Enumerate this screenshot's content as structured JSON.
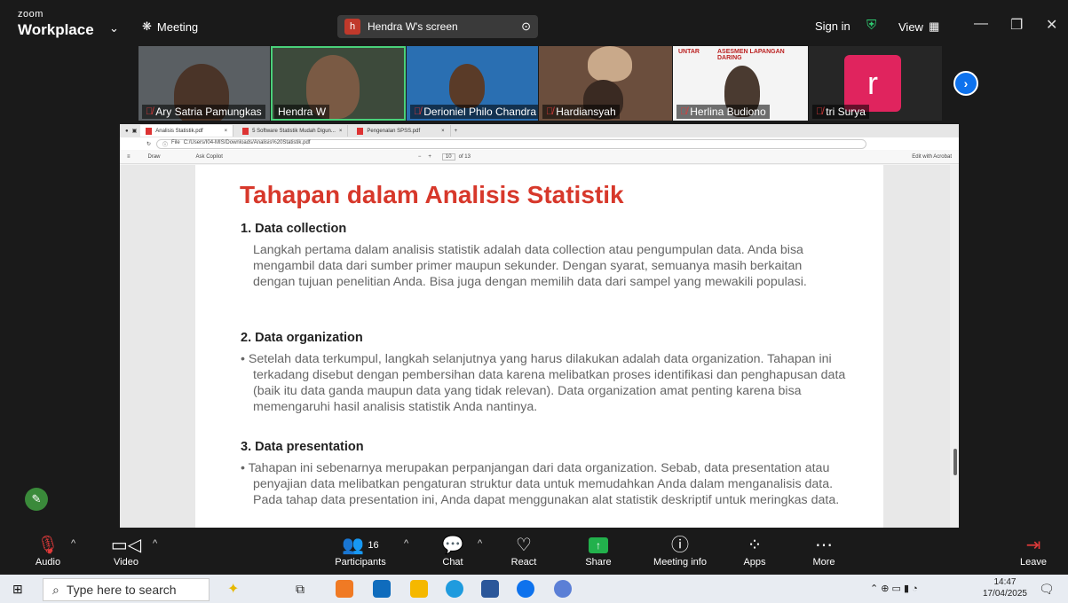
{
  "topbar": {
    "app_small": "zoom",
    "app_big": "Workplace",
    "meeting_label": "Meeting",
    "share_letter": "h",
    "share_label": "Hendra W's screen",
    "sign_in": "Sign in",
    "view": "View"
  },
  "participants_strip": [
    {
      "name": "Ary Satria Pamungkas",
      "muted": true
    },
    {
      "name": "Hendra W",
      "muted": false
    },
    {
      "name": "Derioniel Philo Chandra",
      "muted": true
    },
    {
      "name": "Hardiansyah",
      "muted": true
    },
    {
      "name": "Herlina Budiono",
      "muted": true
    },
    {
      "name": "tri Surya",
      "muted": true,
      "avatar_letter": "r"
    }
  ],
  "banner": {
    "line1": "ASESMEN LAPANGAN DARING",
    "logo": "UNTAR"
  },
  "browser": {
    "tabs": [
      "Analisis Statistik.pdf",
      "5 Software Statistik Mudah Digun...",
      "Pengenalan SPSS.pdf"
    ],
    "url": "C:/Users/I04-MIS/Downloads/Analisis%20Statistik.pdf",
    "url_prefix": "File",
    "toolbar": {
      "draw": "Draw",
      "ask": "Ask Copilot",
      "page": "10",
      "of": "of 13",
      "edit": "Edit with Acrobat"
    }
  },
  "document": {
    "title": "Tahapan dalam Analisis Statistik",
    "s1_heading": "1. Data collection",
    "s1_text": "Langkah pertama dalam analisis statistik adalah data collection atau pengumpulan data. Anda bisa mengambil data dari sumber primer maupun sekunder. Dengan syarat, semuanya masih berkaitan dengan tujuan penelitian Anda. Bisa juga dengan memilih data dari sampel yang mewakili populasi.",
    "s2_heading": "2. Data organization",
    "s2_text": "• Setelah data terkumpul, langkah selanjutnya yang harus dilakukan adalah data organization. Tahapan ini terkadang disebut dengan pembersihan data karena melibatkan proses identifikasi dan penghapusan data (baik itu data ganda maupun data yang tidak relevan). Data organization amat penting karena bisa memengaruhi hasil analisis statistik Anda nantinya.",
    "s3_heading": "3. Data presentation",
    "s3_text": "• Tahapan ini sebenarnya merupakan perpanjangan dari data organization. Sebab, data presentation atau penyajian data melibatkan pengaturan struktur data untuk memudahkan Anda dalam menganalisis data. Pada tahap data presentation ini, Anda dapat menggunakan alat statistik deskriptif untuk meringkas data."
  },
  "controls": {
    "audio": "Audio",
    "video": "Video",
    "participants": "Participants",
    "participants_count": "16",
    "chat": "Chat",
    "react": "React",
    "share": "Share",
    "meeting_info": "Meeting info",
    "apps": "Apps",
    "more": "More",
    "leave": "Leave"
  },
  "taskbar": {
    "search_placeholder": "Type here to search",
    "time": "14:47",
    "date": "17/04/2025"
  },
  "colors": {
    "accent_green": "#22b14c",
    "title_red": "#d7382b",
    "muted_red": "#e03a3a"
  }
}
